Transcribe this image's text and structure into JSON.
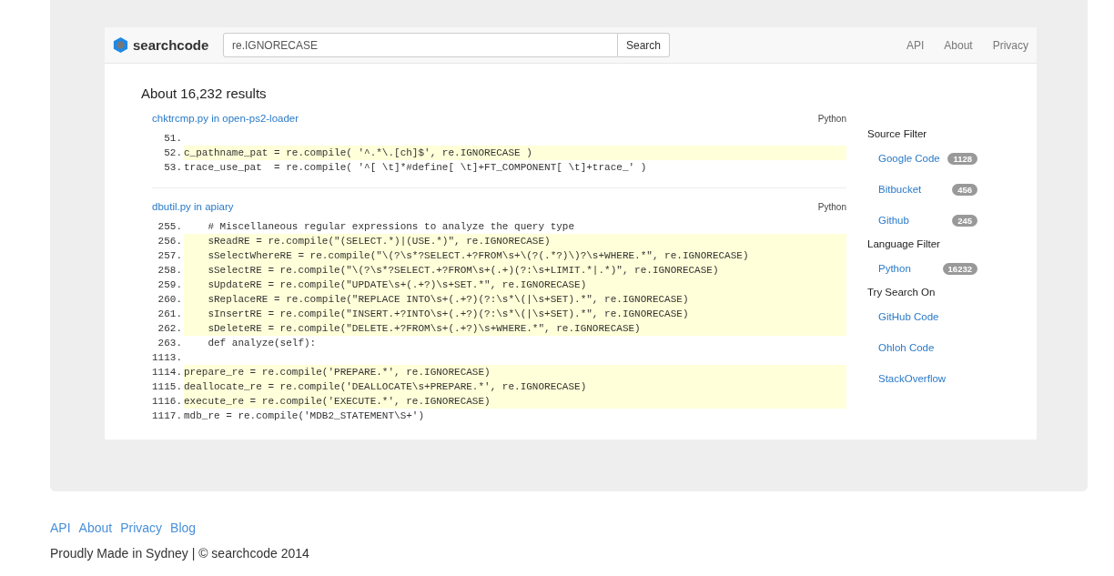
{
  "header": {
    "logo": "searchcode",
    "search": {
      "value": "re.IGNORECASE",
      "button": "Search"
    },
    "nav": [
      "API",
      "About",
      "Privacy"
    ]
  },
  "results_count": "About 16,232 results",
  "results": [
    {
      "title": "chktrcmp.py in open-ps2-loader",
      "language": "Python",
      "lines": [
        {
          "number": "51.",
          "highlighted": false
        },
        {
          "number": "52.",
          "code": "c_pathname_pat = re.compile( '^.*\\.[ch]$', re.IGNORECASE )",
          "highlighted": true
        },
        {
          "number": "53.",
          "code": "trace_use_pat  = re.compile( '^[ \\t]*#define[ \\t]+FT_COMPONENT[ \\t]+trace_' )",
          "highlighted": false
        }
      ]
    },
    {
      "title": "dbutil.py in apiary",
      "language": "Python",
      "lines": [
        {
          "number": "255.",
          "code": "    # Miscellaneous regular expressions to analyze the query type",
          "highlighted": false
        },
        {
          "number": "256.",
          "code": "    sReadRE = re.compile(\"(SELECT.*)|(USE.*)\", re.IGNORECASE)",
          "highlighted": true
        },
        {
          "number": "257.",
          "code": "    sSelectWhereRE = re.compile(\"\\(?\\s*?SELECT.+?FROM\\s+\\(?(.*?)\\)?\\s+WHERE.*\", re.IGNORECASE)",
          "highlighted": true
        },
        {
          "number": "258.",
          "code": "    sSelectRE = re.compile(\"\\(?\\s*?SELECT.+?FROM\\s+(.+)(?:\\s+LIMIT.*|.*)\", re.IGNORECASE)",
          "highlighted": true
        },
        {
          "number": "259.",
          "code": "    sUpdateRE = re.compile(\"UPDATE\\s+(.+?)\\s+SET.*\", re.IGNORECASE)",
          "highlighted": true
        },
        {
          "number": "260.",
          "code": "    sReplaceRE = re.compile(\"REPLACE INTO\\s+(.+?)(?:\\s*\\(|\\s+SET).*\", re.IGNORECASE)",
          "highlighted": true
        },
        {
          "number": "261.",
          "code": "    sInsertRE = re.compile(\"INSERT.+?INTO\\s+(.+?)(?:\\s*\\(|\\s+SET).*\", re.IGNORECASE)",
          "highlighted": true
        },
        {
          "number": "262.",
          "code": "    sDeleteRE = re.compile(\"DELETE.+?FROM\\s+(.+?)\\s+WHERE.*\", re.IGNORECASE)",
          "highlighted": true
        },
        {
          "number": "263.",
          "code": "    def analyze(self):",
          "highlighted": false
        },
        {
          "number": "1113.",
          "highlighted": false
        },
        {
          "number": "1114.",
          "code": "prepare_re = re.compile('PREPARE.*', re.IGNORECASE)",
          "highlighted": true
        },
        {
          "number": "1115.",
          "code": "deallocate_re = re.compile('DEALLOCATE\\s+PREPARE.*', re.IGNORECASE)",
          "highlighted": true
        },
        {
          "number": "1116.",
          "code": "execute_re = re.compile('EXECUTE.*', re.IGNORECASE)",
          "highlighted": true
        },
        {
          "number": "1117.",
          "code": "mdb_re = re.compile('MDB2_STATEMENT\\S+')",
          "highlighted": false
        }
      ]
    }
  ],
  "sidebar": [
    {
      "heading": "Source Filter",
      "items": [
        {
          "label": "Google Code",
          "count": "1128"
        },
        {
          "label": "Bitbucket",
          "count": "456"
        },
        {
          "label": "Github",
          "count": "245"
        }
      ]
    },
    {
      "heading": "Language Filter",
      "items": [
        {
          "label": "Python",
          "count": "16232"
        }
      ]
    },
    {
      "heading": "Try Search On",
      "items": [
        {
          "label": "GitHub Code"
        },
        {
          "label": "Ohloh Code"
        },
        {
          "label": "StackOverflow"
        }
      ]
    }
  ],
  "footer": {
    "links": [
      "API",
      "About",
      "Privacy",
      "Blog"
    ],
    "text": "Proudly Made in Sydney | © searchcode 2014"
  }
}
